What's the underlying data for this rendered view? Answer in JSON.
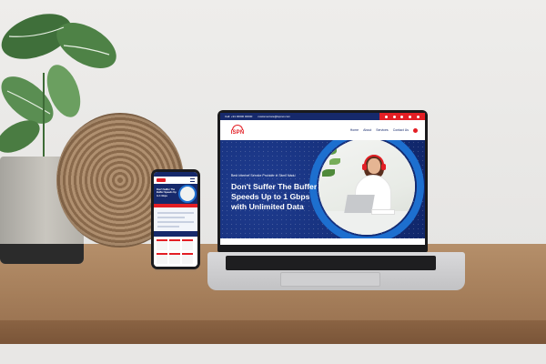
{
  "site": {
    "topbar": {
      "phone": "Call: +91 00000 00000",
      "email": "customercare@ispnet.com"
    },
    "logo_text": "ISPN",
    "nav": [
      "Home",
      "About",
      "Services",
      "Contact Us"
    ],
    "hero": {
      "subtitle": "Best Internet Service Provider in Tamil Nadu",
      "title_lines": [
        "Don't Suffer The Buffer",
        "Speeds Up to 1 Gbps",
        "with Unlimited Data"
      ]
    }
  },
  "phone_site": {
    "hero_title": "Don't Suffer The Buffer Speeds Up to 1 Gbps"
  },
  "colors": {
    "navy": "#16296b",
    "red": "#e31e24",
    "ring_blue": "#1d6fcf"
  },
  "icons": [
    "cart-icon",
    "menu-icon"
  ]
}
